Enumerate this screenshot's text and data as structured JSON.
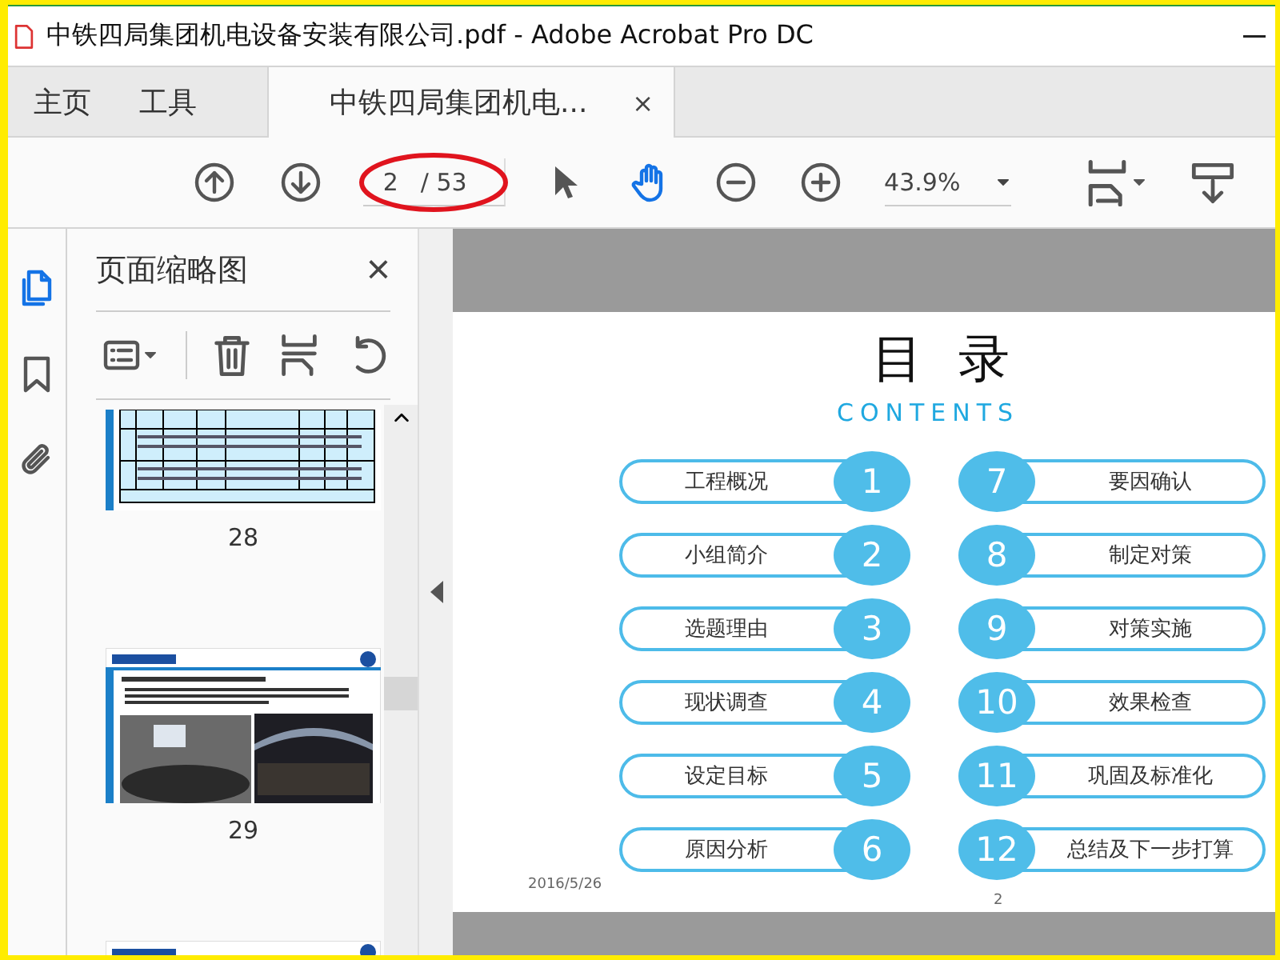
{
  "window": {
    "title": "中铁四局集团机电设备安装有限公司.pdf - Adobe Acrobat Pro DC"
  },
  "tabs": [
    {
      "label": "主页",
      "selected": false,
      "kind": "nav"
    },
    {
      "label": "工具",
      "selected": false,
      "kind": "nav"
    },
    {
      "label": "中铁四局集团机电...",
      "selected": true,
      "kind": "document",
      "close": "×"
    }
  ],
  "toolbar": {
    "page_current": "2",
    "page_total": "/ 53",
    "zoom": "43.9%",
    "tools": [
      {
        "kind": "select",
        "selected": false
      },
      {
        "kind": "hand",
        "selected": true
      }
    ]
  },
  "sidebar": {
    "rail": [
      {
        "kind": "pages",
        "selected": true
      },
      {
        "kind": "bookmarks",
        "selected": false
      },
      {
        "kind": "attachments",
        "selected": false
      }
    ],
    "panel": {
      "title": "页面缩略图",
      "close": "×",
      "thumbnails": [
        {
          "kind": "table",
          "label": "28"
        },
        {
          "kind": "photos",
          "label": "29"
        },
        {
          "kind": "partial"
        }
      ]
    }
  },
  "document": {
    "heading": "目 录",
    "subheading": "CONTENTS",
    "items": [
      {
        "number": "1",
        "label": "工程概况"
      },
      {
        "number": "2",
        "label": "小组简介"
      },
      {
        "number": "3",
        "label": "选题理由"
      },
      {
        "number": "4",
        "label": "现状调查"
      },
      {
        "number": "5",
        "label": "设定目标"
      },
      {
        "number": "6",
        "label": "原因分析"
      },
      {
        "number": "7",
        "label": "要因确认"
      },
      {
        "number": "8",
        "label": "制定对策"
      },
      {
        "number": "9",
        "label": "对策实施"
      },
      {
        "number": "10",
        "label": "效果检查"
      },
      {
        "number": "11",
        "label": "巩固及标准化"
      },
      {
        "number": "12",
        "label": "总结及下一步打算"
      }
    ],
    "footer_date": "2016/5/26",
    "page_number": "2"
  }
}
